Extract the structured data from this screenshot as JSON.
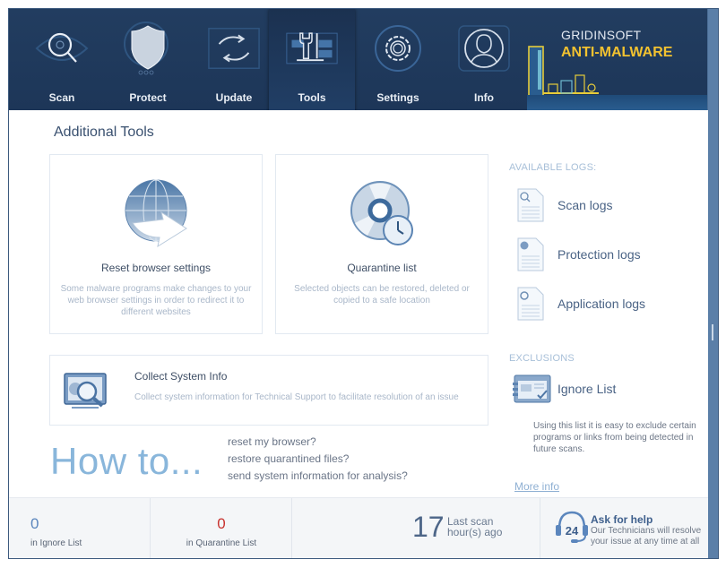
{
  "nav": {
    "items": [
      {
        "label": "Scan",
        "icon": "eye-magnifier-icon"
      },
      {
        "label": "Protect",
        "icon": "shield-globe-icon"
      },
      {
        "label": "Update",
        "icon": "refresh-arrows-icon"
      },
      {
        "label": "Tools",
        "icon": "wrench-tools-icon",
        "active": true
      },
      {
        "label": "Settings",
        "icon": "gear-icon"
      },
      {
        "label": "Info",
        "icon": "user-profile-icon"
      }
    ]
  },
  "brand": {
    "top": "GRIDINSOFT",
    "bottom": "ANTI-MALWARE",
    "accent_color": "#f2c230"
  },
  "main": {
    "section_title": "Additional Tools",
    "cards": [
      {
        "title": "Reset browser settings",
        "description": "Some malware programs make changes to your web browser settings in order to redirect it to different websites",
        "icon": "globe-arrow-icon"
      },
      {
        "title": "Quarantine list",
        "description": "Selected objects can be restored, deleted or copied to a safe location",
        "icon": "quarantine-clock-icon"
      },
      {
        "title": "Collect System Info",
        "description": "Collect system information for Technical Support to facilitate resolution of an issue",
        "icon": "monitor-magnifier-icon"
      }
    ],
    "howto": {
      "title": "How to...",
      "links": [
        "reset my browser?",
        "restore quarantined files?",
        "send system information for analysis?"
      ]
    }
  },
  "side": {
    "logs_heading": "AVAILABLE LOGS:",
    "logs": [
      {
        "label": "Scan logs",
        "icon": "scan-log-icon"
      },
      {
        "label": "Protection logs",
        "icon": "protection-log-icon"
      },
      {
        "label": "Application logs",
        "icon": "application-log-icon"
      }
    ],
    "exclusions_heading": "EXCLUSIONS",
    "ignore_list_label": "Ignore List",
    "ignore_desc": "Using this list it is easy to exclude certain programs or links from being detected in future scans.",
    "more_info": "More info"
  },
  "footer": {
    "ignore_count": "0",
    "ignore_label": "in Ignore List",
    "quarantine_count": "0",
    "quarantine_label": "in Quarantine List",
    "last_scan_value": "17",
    "last_scan_line1": "Last scan",
    "last_scan_line2": "hour(s) ago",
    "help_title": "Ask for help",
    "help_desc": "Our Technicians will resolve your issue at any time at all",
    "help_badge": "24",
    "colors": {
      "ignore": "#5b86bd",
      "quarantine": "#c8332f"
    }
  }
}
